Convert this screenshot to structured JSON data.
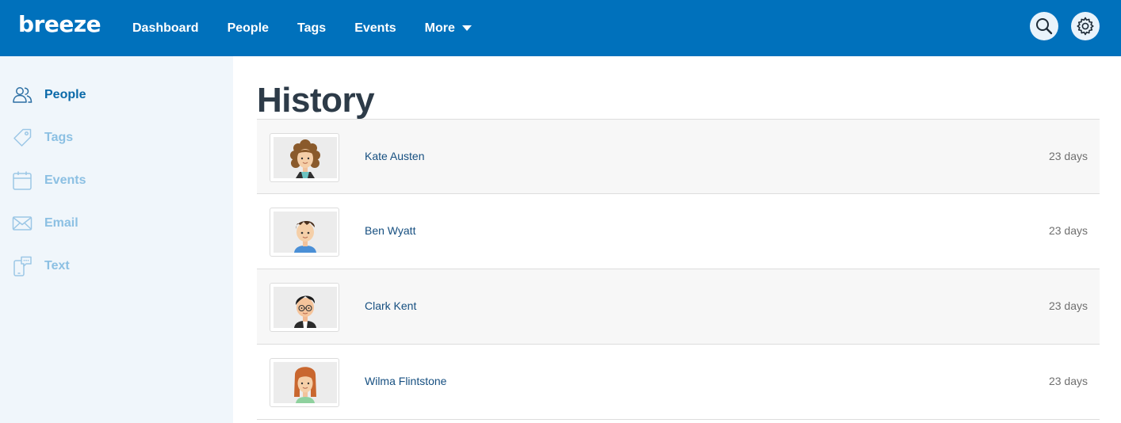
{
  "header": {
    "logo": "breeze",
    "nav": [
      {
        "label": "Dashboard"
      },
      {
        "label": "People"
      },
      {
        "label": "Tags"
      },
      {
        "label": "Events"
      },
      {
        "label": "More"
      }
    ],
    "search_icon": "search-icon",
    "settings_icon": "gear-icon",
    "accent": "#0071bc"
  },
  "sidebar": {
    "items": [
      {
        "label": "People",
        "icon": "people-icon",
        "active": true
      },
      {
        "label": "Tags",
        "icon": "tag-icon",
        "active": false
      },
      {
        "label": "Events",
        "icon": "calendar-icon",
        "active": false
      },
      {
        "label": "Email",
        "icon": "envelope-icon",
        "active": false
      },
      {
        "label": "Text",
        "icon": "phone-message-icon",
        "active": false
      }
    ]
  },
  "main": {
    "title": "History",
    "rows": [
      {
        "name": "Kate Austen",
        "time": "23 days",
        "avatar": "curly-brown-hair-woman-avatar"
      },
      {
        "name": "Ben Wyatt",
        "time": "23 days",
        "avatar": "brown-hair-man-avatar"
      },
      {
        "name": "Clark Kent",
        "time": "23 days",
        "avatar": "glasses-man-avatar"
      },
      {
        "name": "Wilma Flintstone",
        "time": "23 days",
        "avatar": "red-hair-woman-avatar"
      }
    ]
  }
}
